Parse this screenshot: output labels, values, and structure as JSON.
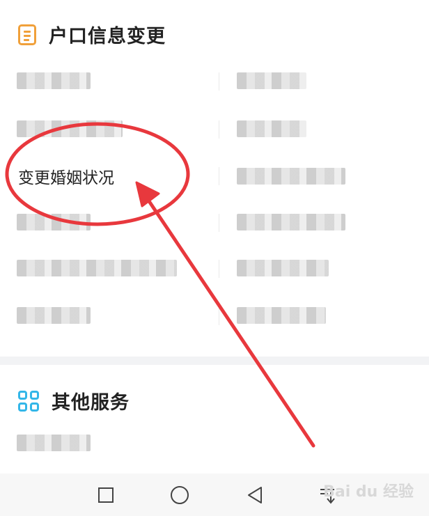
{
  "hukou_section": {
    "title": "户口信息变更",
    "icon": "document-icon",
    "highlighted_item": "变更婚姻状况"
  },
  "other_section": {
    "title": "其他服务",
    "icon": "grid-icon"
  },
  "navbar": {
    "square": "recent-apps-icon",
    "circle": "home-icon",
    "triangle": "back-icon",
    "extra": "menu-down-icon"
  },
  "watermark": "Bai du 经验",
  "colors": {
    "accent_orange": "#f0a03a",
    "accent_blue": "#33b6e8",
    "annotation_red": "#e8383d"
  }
}
